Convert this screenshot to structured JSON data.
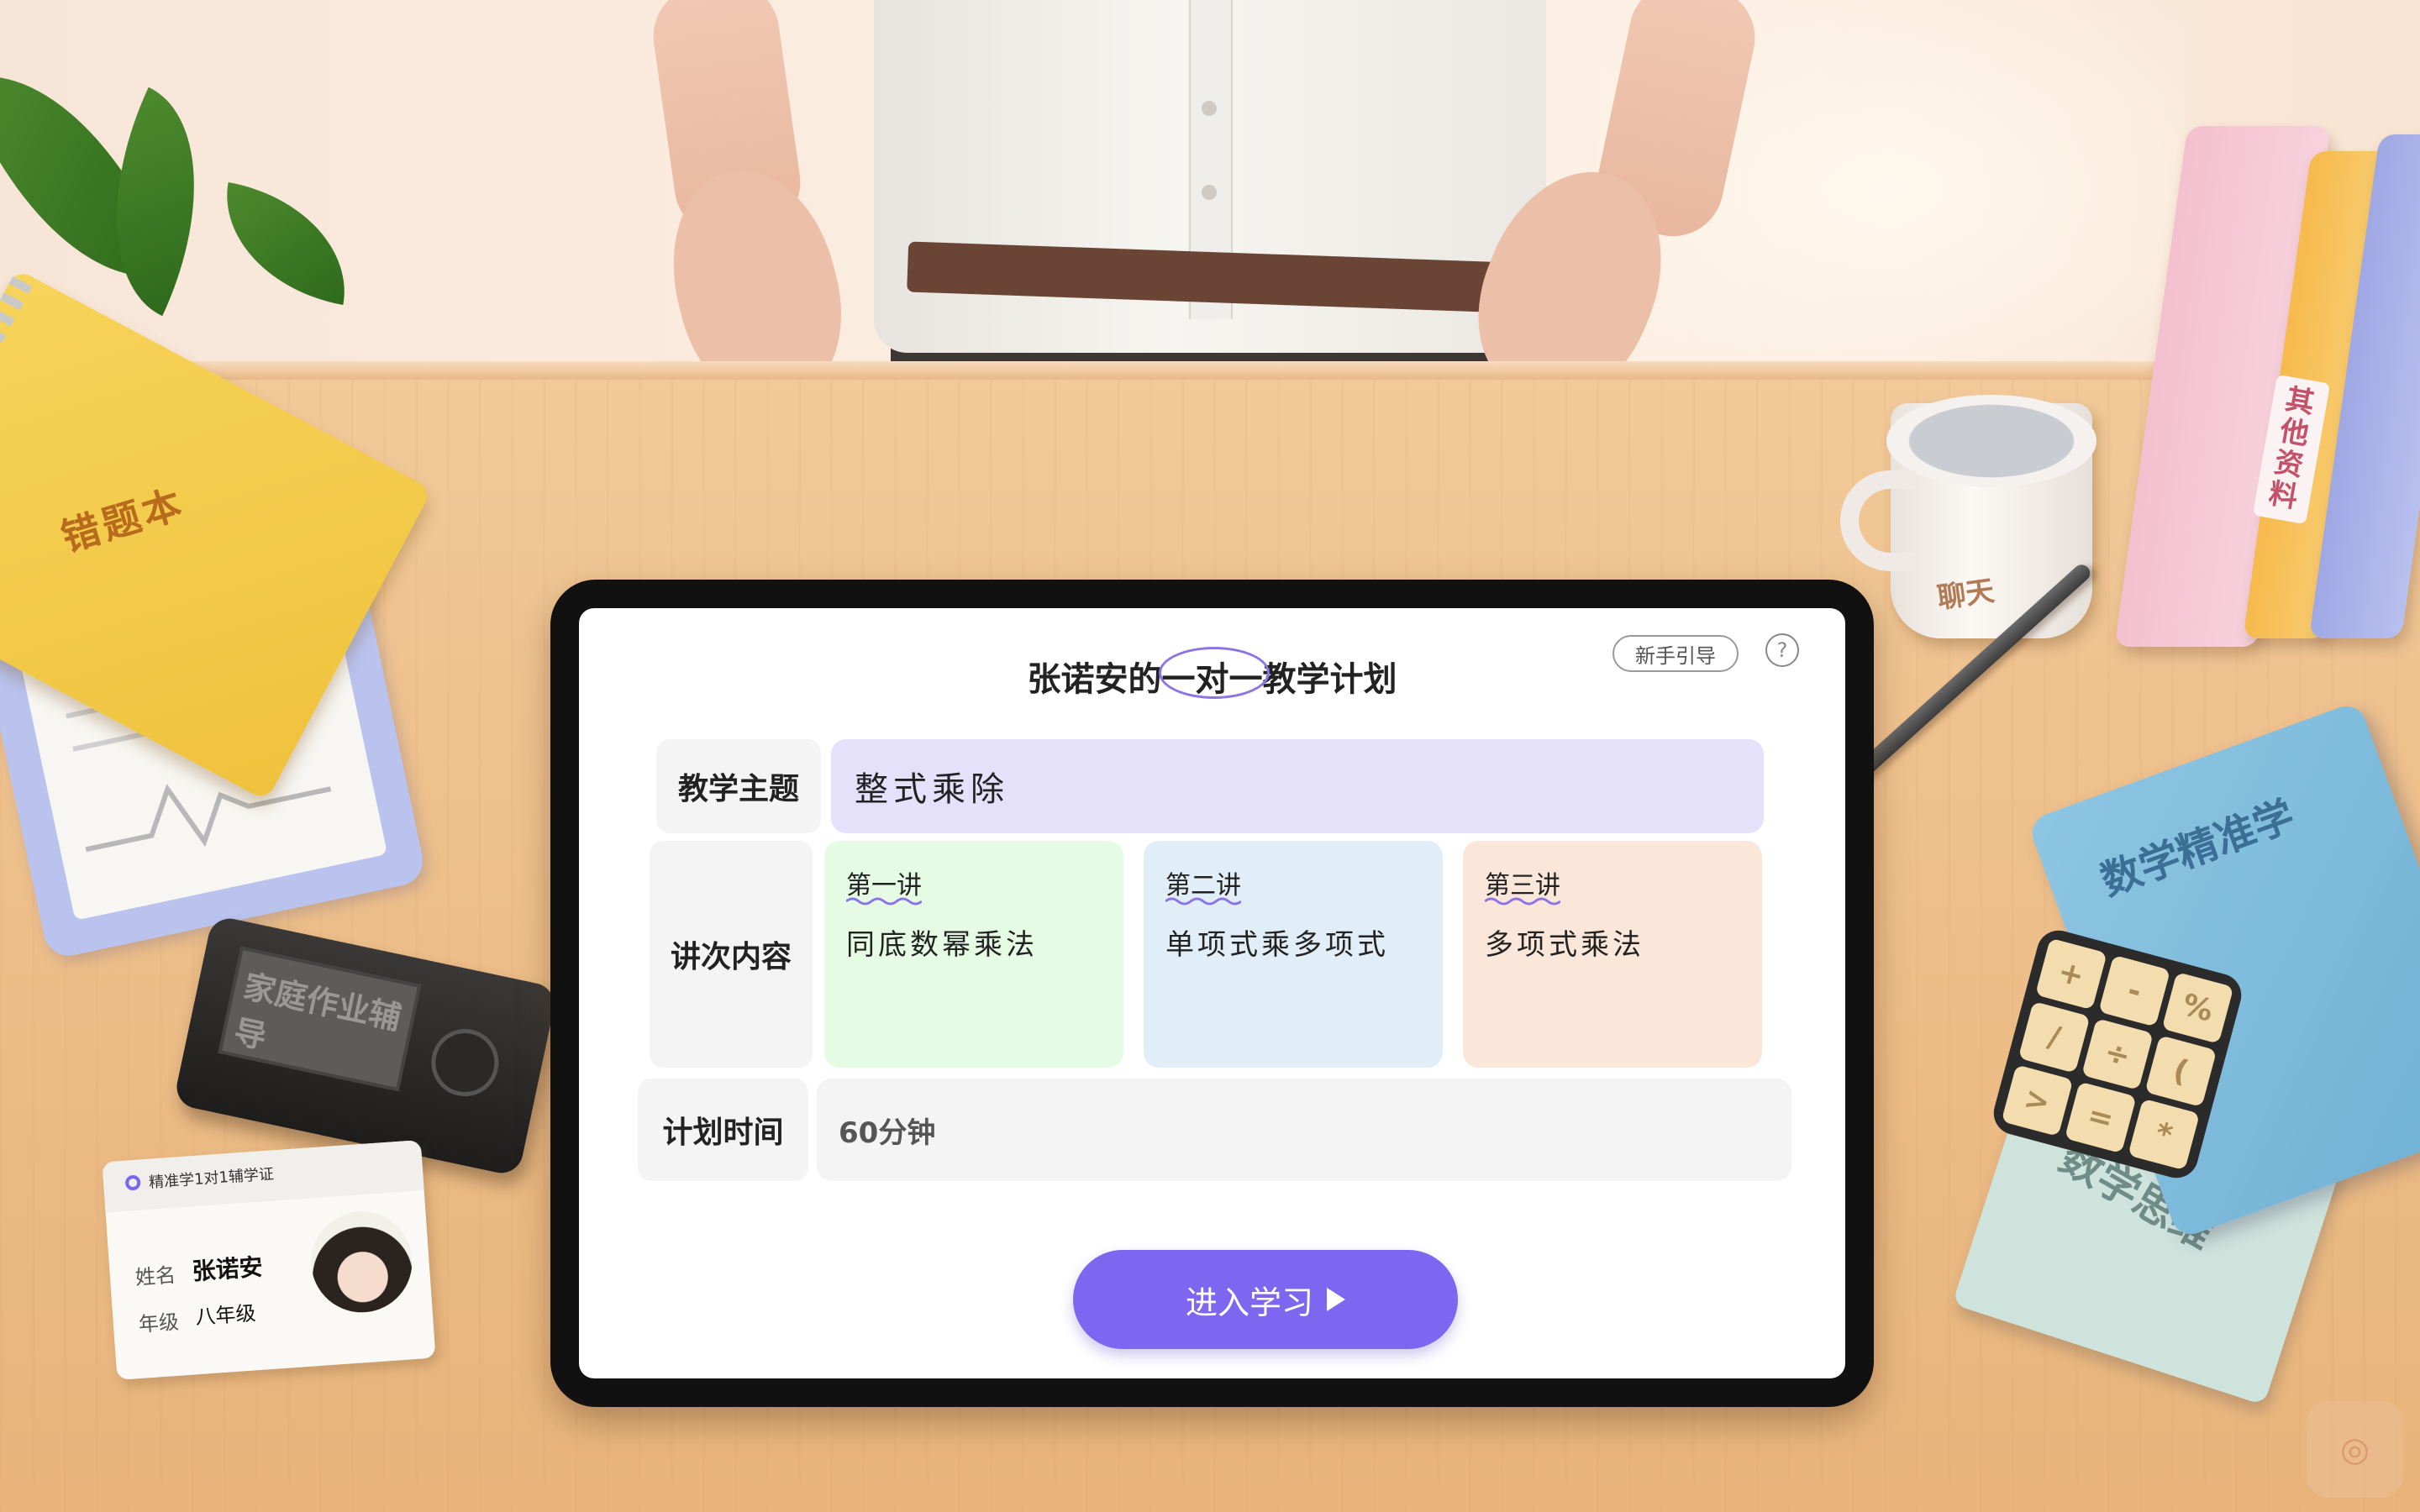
{
  "app": {
    "plan_title": "张诺安的一对一教学计划",
    "guide_label": "新手引导",
    "help_label": "?",
    "accent_color": "#7d66f0"
  },
  "plan": {
    "topic_label": "教学主题",
    "topic_value": "整式乘除",
    "lectures_label": "讲次内容",
    "lectures": [
      {
        "number": "第一讲",
        "content": "同底数幂乘法",
        "color": "#e6fbe4"
      },
      {
        "number": "第二讲",
        "content": "单项式乘多项式",
        "color": "#e2eef7"
      },
      {
        "number": "第三讲",
        "content": "多项式乘法",
        "color": "#fbe6da"
      }
    ],
    "time_label": "计划时间",
    "time_value": "60分钟",
    "enter_button": "进入学习"
  },
  "desk_items": {
    "notebook_title": "错题本",
    "camera_label": "家庭作业辅导",
    "cup_label": "聊天",
    "binder_label": "其他资料",
    "blue_book_title": "数学精准学",
    "green_book_title": "数学思维",
    "cube_symbols": [
      "+",
      "-",
      "%",
      "/",
      "÷",
      "(",
      ">",
      "=",
      "*"
    ],
    "id_card": {
      "title": "精准学1对1辅学证",
      "name_label": "姓名",
      "name_value": "张诺安",
      "grade_label": "年级",
      "grade_value": "八年级"
    },
    "corner_icon": "app-badge-icon"
  }
}
